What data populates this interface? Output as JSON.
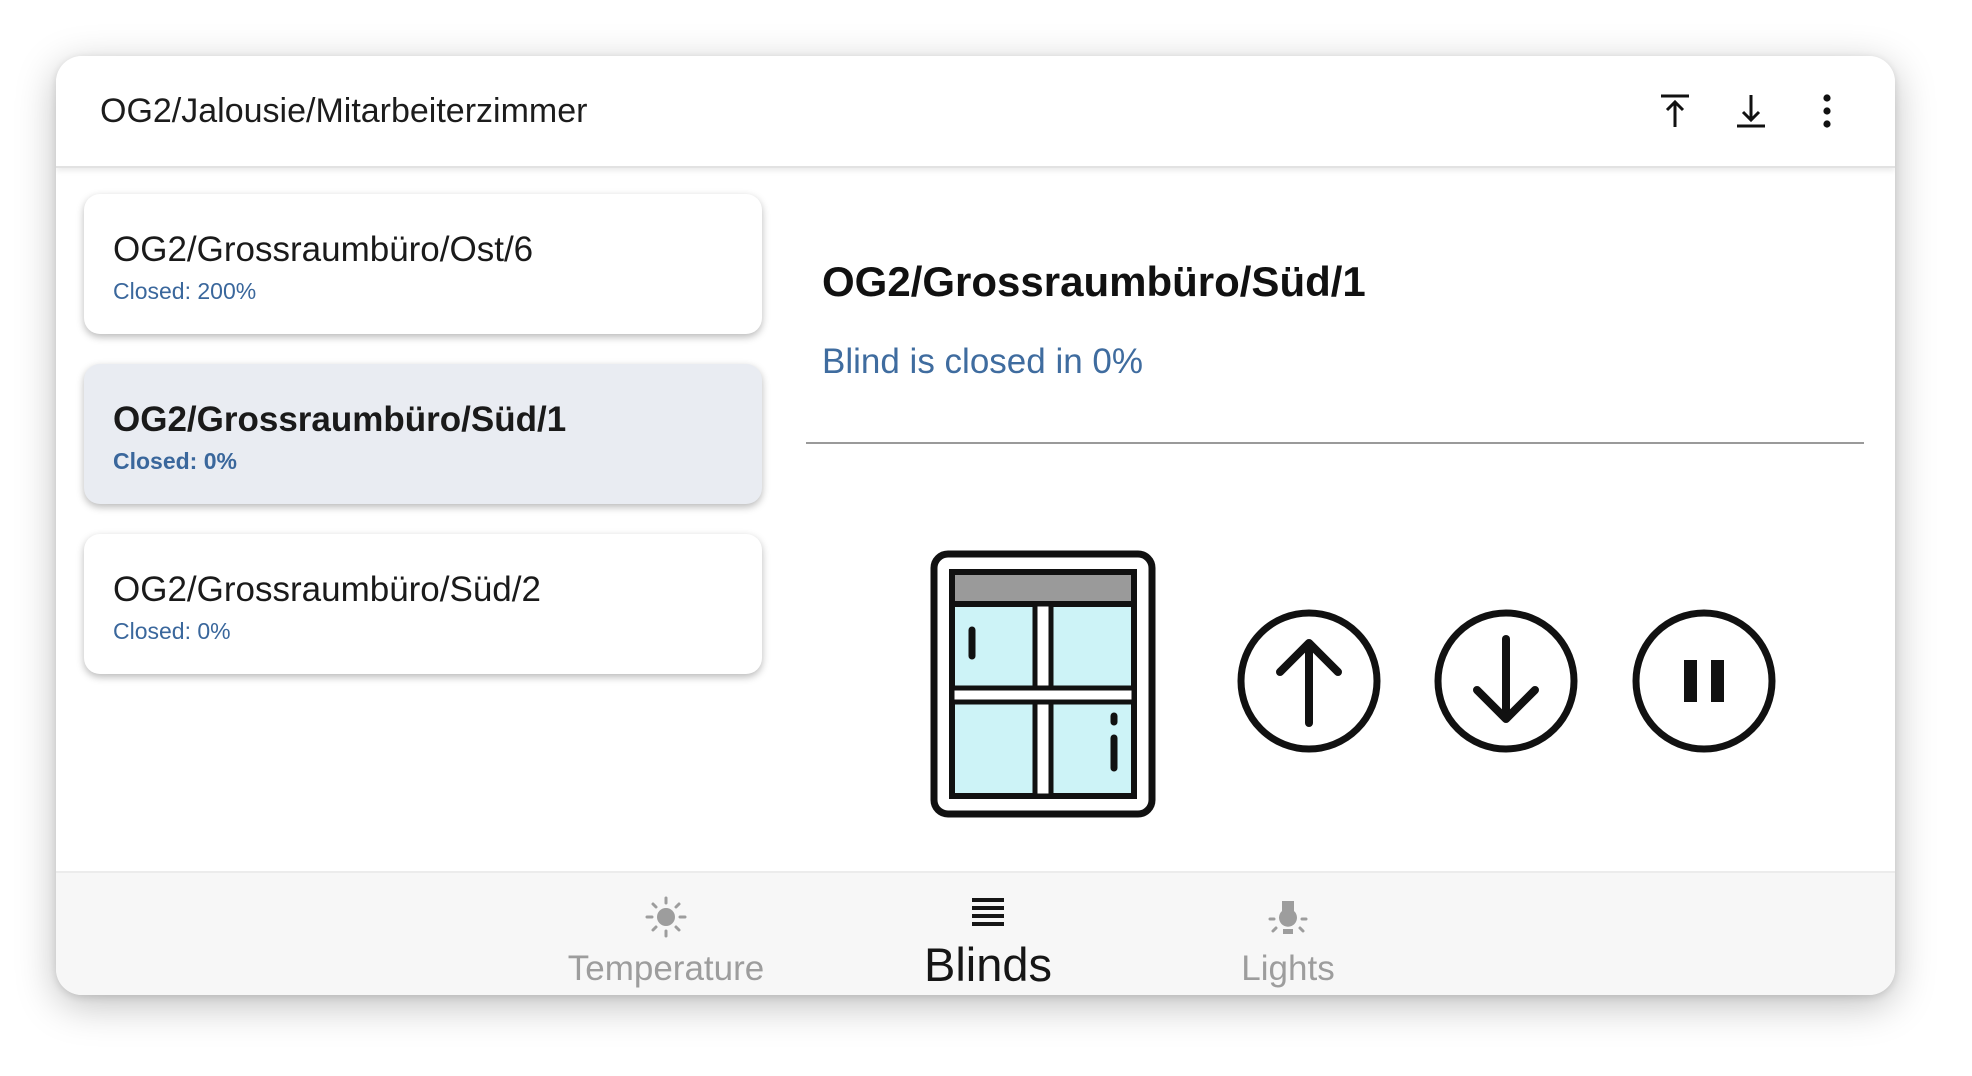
{
  "appbar": {
    "title": "OG2/Jalousie/Mitarbeiterzimmer",
    "actions": [
      "move-to-top-icon",
      "move-to-bottom-icon",
      "more-vert-icon"
    ]
  },
  "blinds": [
    {
      "name": "OG2/Grossraumbüro/Ost/6",
      "status": "Closed: 200%",
      "selected": false
    },
    {
      "name": "OG2/Grossraumbüro/Süd/1",
      "status": "Closed: 0%",
      "selected": true
    },
    {
      "name": "OG2/Grossraumbüro/Süd/2",
      "status": "Closed: 0%",
      "selected": false
    }
  ],
  "detail": {
    "title": "OG2/Grossraumbüro/Süd/1",
    "status": "Blind is closed in 0%",
    "controls": [
      "arrow-up-circle-icon",
      "arrow-down-circle-icon",
      "pause-circle-icon"
    ]
  },
  "nav": {
    "items": [
      {
        "label": "Temperature",
        "icon": "sun-icon",
        "active": false
      },
      {
        "label": "Blinds",
        "icon": "blinds-icon",
        "active": true
      },
      {
        "label": "Lights",
        "icon": "lightbulb-icon",
        "active": false
      }
    ]
  },
  "colors": {
    "status_blue": "#3a679c",
    "selected_card": "#e9ecf2",
    "window_glass": "#cdf3f7"
  }
}
